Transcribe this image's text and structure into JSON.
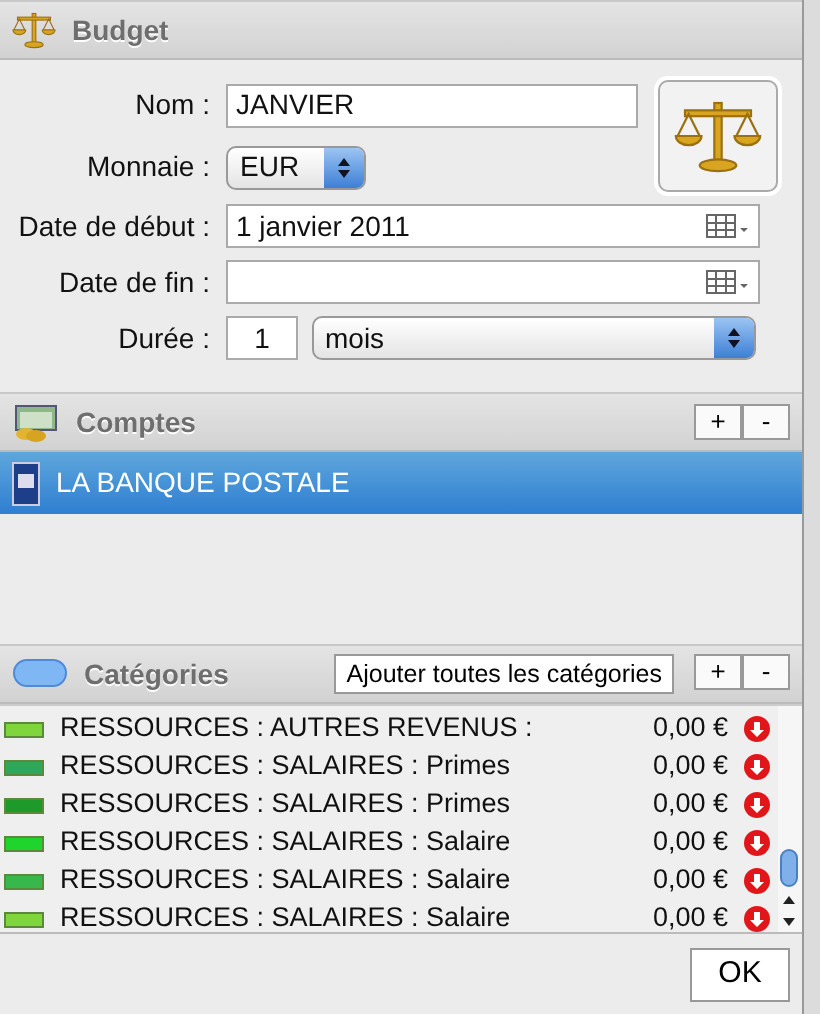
{
  "title": "Budget",
  "form": {
    "name_label": "Nom :",
    "name_value": "JANVIER",
    "currency_label": "Monnaie :",
    "currency_value": "EUR",
    "start_label": "Date de début :",
    "start_value": "1 janvier 2011",
    "end_label": "Date de fin :",
    "duration_label": "Durée :",
    "duration_value": "1",
    "duration_unit": "mois"
  },
  "accounts": {
    "title": "Comptes",
    "add": "+",
    "remove": "-",
    "items": [
      {
        "name": "LA BANQUE POSTALE",
        "selected": true
      }
    ]
  },
  "categories": {
    "title": "Catégories",
    "add_all": "Ajouter toutes les catégories",
    "add": "+",
    "remove": "-",
    "items": [
      {
        "name": "RESSOURCES : AUTRES REVENUS :",
        "amount": "0,00 €",
        "color": "#7ed63c"
      },
      {
        "name": "RESSOURCES : SALAIRES : Primes",
        "amount": "0,00 €",
        "color": "#2fa85c"
      },
      {
        "name": "RESSOURCES : SALAIRES : Primes",
        "amount": "0,00 €",
        "color": "#1e9a2a"
      },
      {
        "name": "RESSOURCES : SALAIRES : Salaire",
        "amount": "0,00 €",
        "color": "#1fd42c"
      },
      {
        "name": "RESSOURCES : SALAIRES : Salaire",
        "amount": "0,00 €",
        "color": "#36b84c"
      },
      {
        "name": "RESSOURCES : SALAIRES : Salaire",
        "amount": "0,00 €",
        "color": "#7ed63c"
      }
    ]
  },
  "ok": "OK"
}
